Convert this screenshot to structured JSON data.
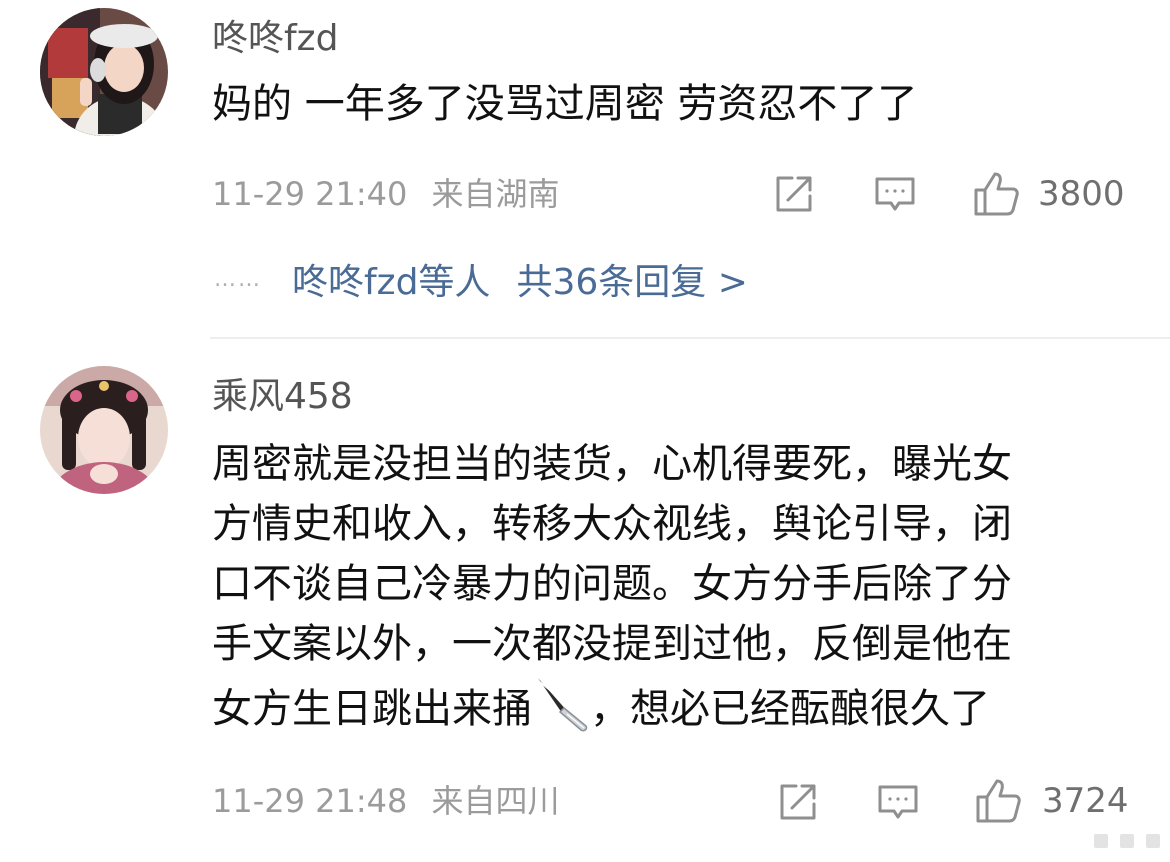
{
  "comments": [
    {
      "username": "咚咚fzd",
      "content_lines": [
        "妈的 一年多了没骂过周密 劳资忍不了了"
      ],
      "timestamp": "11-29 21:40",
      "location": "来自湖南",
      "likes": "3800",
      "replies": {
        "dots": "……",
        "who": "咚咚fzd等人",
        "count": "共36条回复 >"
      }
    },
    {
      "username": "乘风458",
      "content_lines": [
        "周密就是没担当的装货，心机得要死，曝光女",
        "方情史和收入，转移大众视线，舆论引导，闭",
        "口不谈自己冷暴力的问题。女方分手后除了分",
        "手文案以外，一次都没提到过他，反倒是他在",
        "女方生日跳出来捅",
        "，想必已经酝酿很久了"
      ],
      "emoji": "knife-emoji",
      "timestamp": "11-29 21:48",
      "location": "来自四川",
      "likes": "3724"
    }
  ],
  "icons": [
    "share-icon",
    "comment-icon",
    "like-icon",
    "ellipsis-icon",
    "knife-icon"
  ],
  "colors": {
    "link": "#4a6b96",
    "meta": "#9b9b9b",
    "text": "#111111",
    "username": "#555555"
  }
}
